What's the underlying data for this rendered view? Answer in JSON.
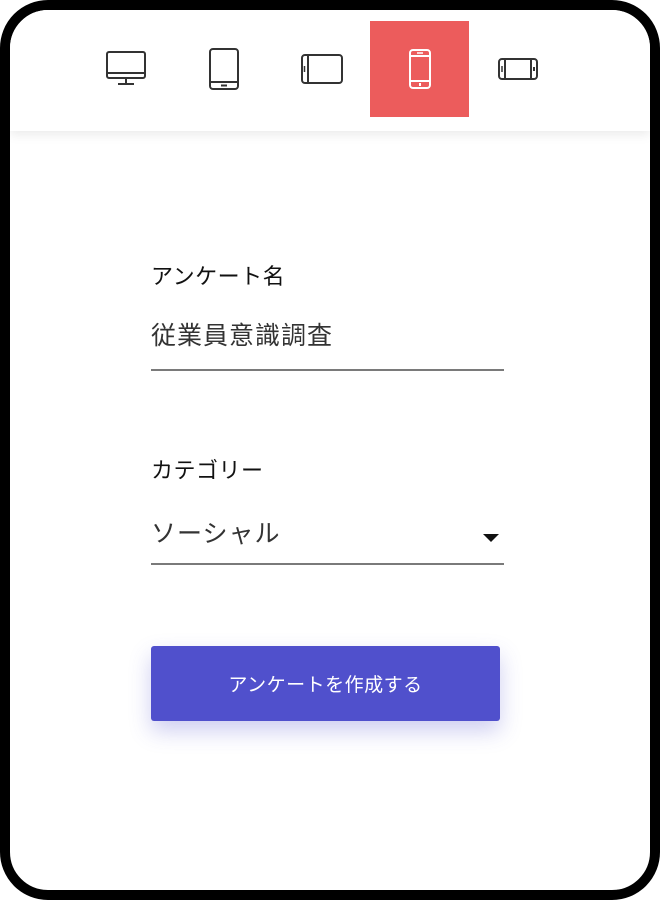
{
  "toolbar": {
    "devices": [
      {
        "icon": "desktop-monitor-icon",
        "active": false
      },
      {
        "icon": "tablet-portrait-icon",
        "active": false
      },
      {
        "icon": "tablet-landscape-icon",
        "active": false
      },
      {
        "icon": "phone-portrait-icon",
        "active": true
      },
      {
        "icon": "phone-landscape-icon",
        "active": false
      }
    ],
    "active_color": "#ec5c5c"
  },
  "form": {
    "survey_name_label": "アンケート名",
    "survey_name_value": "従業員意識調査",
    "category_label": "カテゴリー",
    "category_value": "ソーシャル",
    "submit_label": "アンケートを作成する",
    "submit_color": "#5050cc"
  }
}
